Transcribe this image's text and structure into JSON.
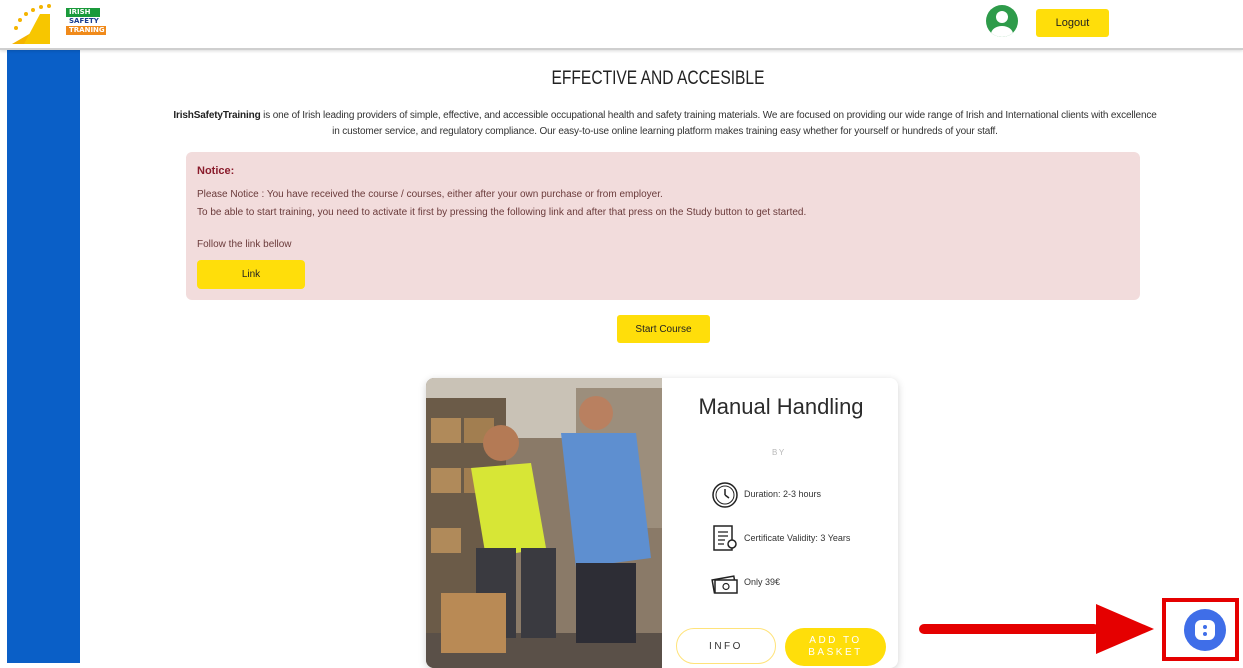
{
  "header": {
    "logo_lines": [
      "IRISH",
      "SAFETY",
      "TRANING"
    ],
    "logout_label": "Logout"
  },
  "main": {
    "title": "EFFECTIVE AND ACCESIBLE",
    "intro_brand": "IrishSafetyTraining",
    "intro_text": " is one of Irish leading providers of simple, effective, and accessible occupational health and safety training materials. We are focused on providing our wide range of Irish and International clients with excellence in customer service, and regulatory compliance. Our easy-to-use online learning platform makes training easy whether for yourself or hundreds of your staff."
  },
  "notice": {
    "title": "Notice:",
    "line1": "Please Notice : You have received the course / courses, either after your own purchase or from employer.",
    "line2": "To be able to start training, you need to activate it first by pressing the following link and after that press on the Study button to get started.",
    "line3": "Follow the link bellow",
    "link_label": "Link"
  },
  "start_course_label": "Start Course",
  "course": {
    "title": "Manual Handling",
    "by": "BY",
    "duration": "Duration: 2-3 hours",
    "validity": "Certificate Validity: 3 Years",
    "price": "Only 39€",
    "info_label": "INFO",
    "basket_label": "ADD TO BASKET"
  },
  "colors": {
    "accent_yellow": "#ffde0a",
    "sidebar_blue": "#0a5fc7",
    "notice_bg": "#f2dcdc",
    "annotation_red": "#e50000",
    "chat_blue": "#3f6ee8"
  }
}
